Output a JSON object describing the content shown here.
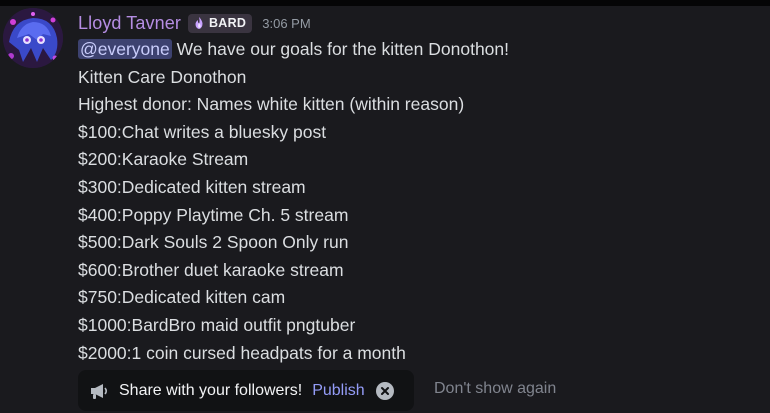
{
  "message": {
    "author": "Lloyd Tavner",
    "badge": {
      "label": "BARD",
      "icon": "purple-flame-icon"
    },
    "timestamp": "3:06 PM",
    "mention": "@everyone",
    "first_line_text": " We have our goals for the kitten Donothon!",
    "lines": [
      "Kitten Care Donothon",
      "Highest donor: Names white kitten (within reason)",
      "$100:Chat writes a bluesky post",
      "$200:Karaoke Stream",
      "$300:Dedicated kitten stream",
      "$400:Poppy Playtime Ch. 5 stream",
      "$500:Dark Souls 2 Spoon Only run",
      "$600:Brother duet karaoke stream",
      "$750:Dedicated kitten cam",
      "$1000:BardBro maid outfit pngtuber",
      "$2000:1 coin cursed headpats for a month"
    ]
  },
  "share_prompt": {
    "icon": "megaphone-icon",
    "text": "Share with your followers!",
    "publish_label": "Publish",
    "close_icon": "close-icon",
    "dont_show_label": "Don't show again"
  },
  "colors": {
    "background": "#1a1a1e",
    "username": "#b58de3",
    "text": "#dbdee1",
    "mention_bg": "#3d4270",
    "link": "#949cf7",
    "muted": "#80848e"
  }
}
